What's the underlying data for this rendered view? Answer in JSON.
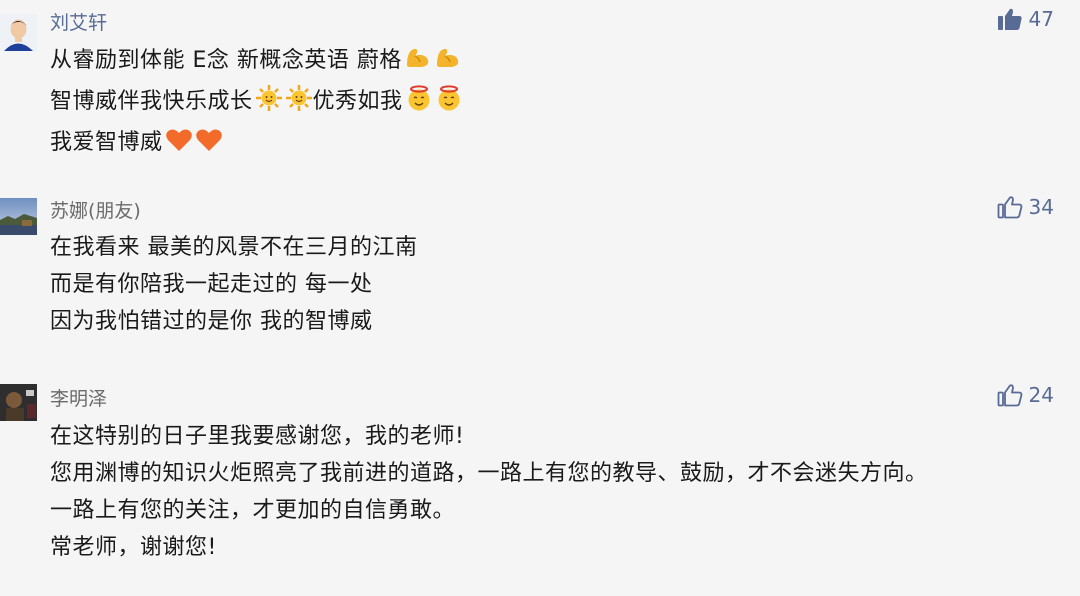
{
  "comments": [
    {
      "name": "刘艾轩",
      "likes": "47",
      "liked": true,
      "lines": [
        {
          "text": "从睿励到体能 E念 新概念英语 蔚格",
          "emojis": [
            "flexed-biceps-icon",
            "flexed-biceps-icon"
          ]
        },
        {
          "text": "智博威伴我快乐成长",
          "emojis": [
            "sun-icon",
            "sun-icon"
          ],
          "text2": "优秀如我",
          "emojis2": [
            "smiling-face-with-halo-icon",
            "smiling-face-with-halo-icon"
          ]
        },
        {
          "text": "我爱智博威",
          "emojis": [
            "orange-heart-icon",
            "orange-heart-icon"
          ]
        }
      ]
    },
    {
      "name": "苏娜(朋友)",
      "likes": "34",
      "liked": false,
      "lines": [
        {
          "text": "在我看来 最美的风景不在三月的江南"
        },
        {
          "text": "而是有你陪我一起走过的 每一处"
        },
        {
          "text": "因为我怕错过的是你 我的智博威"
        }
      ]
    },
    {
      "name": "李明泽",
      "likes": "24",
      "liked": false,
      "lines": [
        {
          "text": "在这特别的日子里我要感谢您，我的老师!"
        },
        {
          "text": "您用渊博的知识火炬照亮了我前进的道路，一路上有您的教导、鼓励，才不会迷失方向。"
        },
        {
          "text": "一路上有您的关注，才更加的自信勇敢。"
        },
        {
          "text": "常老师，谢谢您!"
        }
      ]
    }
  ],
  "colors": {
    "background": "#f5f5f5",
    "name": "#576b95",
    "text": "#1a1a1a"
  }
}
